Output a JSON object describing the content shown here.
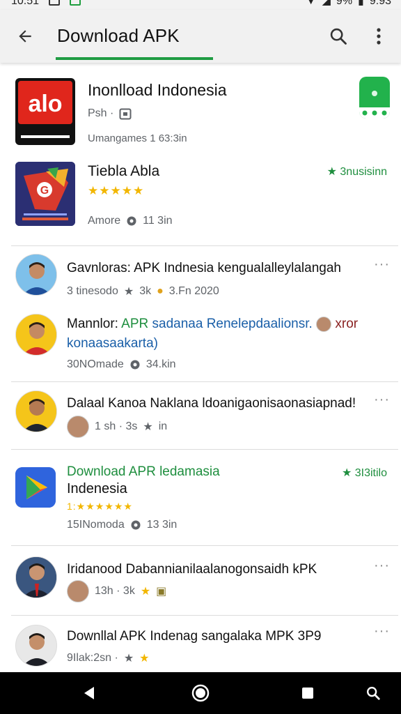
{
  "status_bar": {
    "time": "10:51",
    "battery": "9%",
    "clock_right": "9:93"
  },
  "app_bar": {
    "title": "Download APK"
  },
  "colors": {
    "accent": "#1f9c43",
    "star": "#f2b600",
    "link": "#1a5fa8"
  },
  "apps": [
    {
      "title": "Inonlload Indonesia",
      "meta_a": "Psh ·",
      "meta_b": "Umangames 1 63:3in",
      "icon": "alo-download-logo",
      "badge_icon": "green-app-badge"
    },
    {
      "title": "Tiebla Abla",
      "stars": "★★★★★",
      "rating": "★ 3nusisinn",
      "meta_a": "Amore",
      "meta_b": "11 3in",
      "icon": "g-shield-logo"
    }
  ],
  "posts": [
    {
      "title": "Gavnloras: APK Indnesia kengualalleylalangah",
      "meta": "3 tinesodo",
      "meta2": "3k",
      "meta3": "3.Fn 2020",
      "icon": "avatar-man-blue"
    },
    {
      "title_a": "Mannlor:",
      "title_b": "APR",
      "title_c": "sadanaa Renelepdaalionsr.",
      "title_d": "xror",
      "title_line2": "konaasaakarta)",
      "meta": "30NOmade",
      "meta2": "34.kin",
      "icon": "avatar-man-red"
    },
    {
      "title": "Dalaal Kanoa Naklana ldoanigaonisaonasiapnad!",
      "meta": "1 sh · 3s",
      "meta2": "in",
      "icon": "avatar-man-green"
    }
  ],
  "featured": {
    "title": "Download APR ledamasia",
    "title_line2": "Indenesia",
    "rating": "★ 3I3itilo",
    "stars": "1:★★★★★★",
    "meta": "15INomoda",
    "meta2": "13 3in",
    "icon": "play-store-icon"
  },
  "posts2": [
    {
      "title": "Iridanood Dabannianilaalanogonsaidh kPK",
      "meta": "13h · 3k",
      "icon": "avatar-man-suit"
    },
    {
      "title": "Downllal APK Indenag sangalaka MPK 3P9",
      "meta": "9Ilak:2sn ·",
      "icon": "avatar-man-dark"
    }
  ]
}
